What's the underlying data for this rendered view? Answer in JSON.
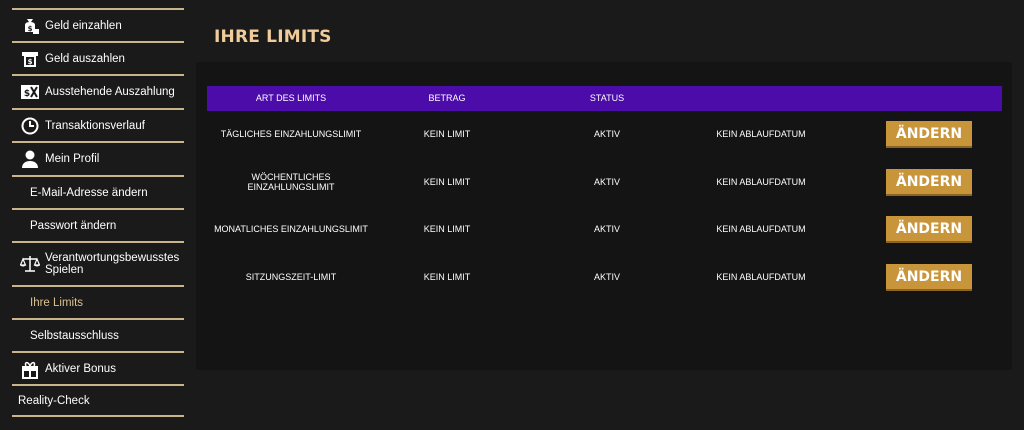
{
  "sidebar": {
    "items": [
      {
        "label": "Geld einzahlen",
        "icon": "money-bag-icon"
      },
      {
        "label": "Geld auszahlen",
        "icon": "atm-icon"
      },
      {
        "label": "Ausstehende Auszahlung",
        "icon": "pending-money-icon"
      },
      {
        "label": "Transaktionsverlauf",
        "icon": "clock-icon"
      },
      {
        "label": "Mein Profil",
        "icon": "user-icon"
      },
      {
        "label": "E-Mail-Adresse ändern"
      },
      {
        "label": "Passwort ändern"
      },
      {
        "label": "Verantwortungsbewusstes Spielen",
        "icon": "scales-icon"
      },
      {
        "label": "Ihre Limits"
      },
      {
        "label": "Selbstausschluss"
      },
      {
        "label": "Aktiver Bonus",
        "icon": "gift-icon"
      },
      {
        "label": "Reality-Check"
      }
    ]
  },
  "page": {
    "title": "IHRE LIMITS"
  },
  "table": {
    "headers": [
      "ART DES LIMITS",
      "BETRAG",
      "STATUS"
    ],
    "rows": [
      {
        "type": "TÄGLICHES EINZAHLUNGSLIMIT",
        "amount": "KEIN LIMIT",
        "status": "AKTIV",
        "expiry": "KEIN ABLAUFDATUM",
        "action": "ÄNDERN"
      },
      {
        "type": "WÖCHENTLICHES EINZAHLUNGSLIMIT",
        "amount": "KEIN LIMIT",
        "status": "AKTIV",
        "expiry": "KEIN ABLAUFDATUM",
        "action": "ÄNDERN"
      },
      {
        "type": "MONATLICHES EINZAHLUNGSLIMIT",
        "amount": "KEIN LIMIT",
        "status": "AKTIV",
        "expiry": "KEIN ABLAUFDATUM",
        "action": "ÄNDERN"
      },
      {
        "type": "SITZUNGSZEIT-LIMIT",
        "amount": "KEIN LIMIT",
        "status": "AKTIV",
        "expiry": "KEIN ABLAUFDATUM",
        "action": "ÄNDERN"
      }
    ]
  },
  "colors": {
    "accent": "#c9953a",
    "header": "#4b0ca9",
    "title": "#f1cc9a",
    "active": "#d9c08f",
    "divider": "#c8b68a"
  }
}
